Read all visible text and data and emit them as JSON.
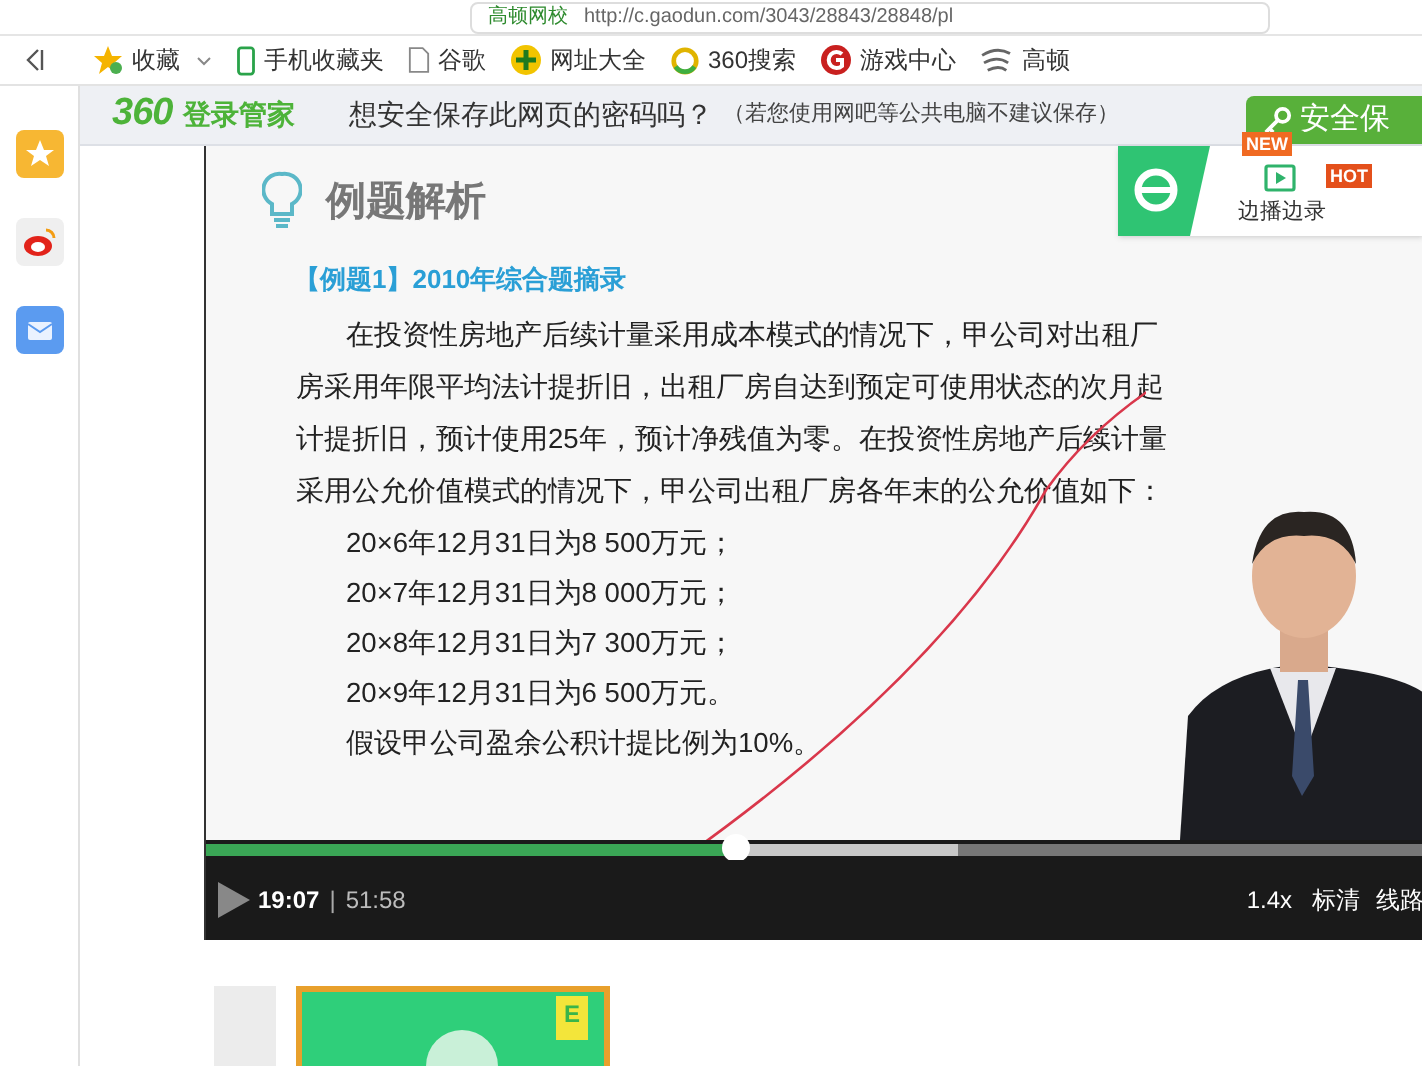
{
  "address_bar": {
    "site": "高顿网校",
    "url": "http://c.gaodun.com/3043/28843/28848/pl"
  },
  "bookmarks": [
    {
      "label": "收藏",
      "kind": "favorites"
    },
    {
      "label": "手机收藏夹",
      "kind": "phone"
    },
    {
      "label": "谷歌",
      "kind": "page"
    },
    {
      "label": "网址大全",
      "kind": "portal"
    },
    {
      "label": "360搜索",
      "kind": "search"
    },
    {
      "label": "游戏中心",
      "kind": "games"
    },
    {
      "label": "高顿",
      "kind": "swirl"
    }
  ],
  "password_bar": {
    "brand": "360",
    "product": "登录管家",
    "question": "想安全保存此网页的密码吗？",
    "note": "（若您使用网吧等公共电脑不建议保存）",
    "button": "安全保"
  },
  "player_overlay": {
    "badge_new": "NEW",
    "action": "边播边录",
    "badge_hot": "HOT"
  },
  "slide": {
    "title": "例题解析",
    "subtitle": "【例题1】2010年综合题摘录",
    "paragraph": "在投资性房地产后续计量采用成本模式的情况下，甲公司对出租厂房采用年限平均法计提折旧，出租厂房自达到预定可使用状态的次月起计提折旧，预计使用25年，预计净残值为零。在投资性房地产后续计量采用公允价值模式的情况下，甲公司出租厂房各年末的公允价值如下：",
    "lines": [
      "20×6年12月31日为8 500万元；",
      "20×7年12月31日为8 000万元；",
      "20×8年12月31日为7 300万元；",
      "20×9年12月31日为6 500万元。",
      "假设甲公司盈余公积计提比例为10%。"
    ]
  },
  "player": {
    "progress": {
      "level": 0.435
    },
    "buffer": {
      "level": 0.617
    },
    "elapsed": "19:07",
    "separator": "|",
    "duration": "51:58",
    "speed": "1.4x",
    "quality": "标清",
    "route": "线路"
  },
  "course_card": {
    "badge": "E"
  }
}
